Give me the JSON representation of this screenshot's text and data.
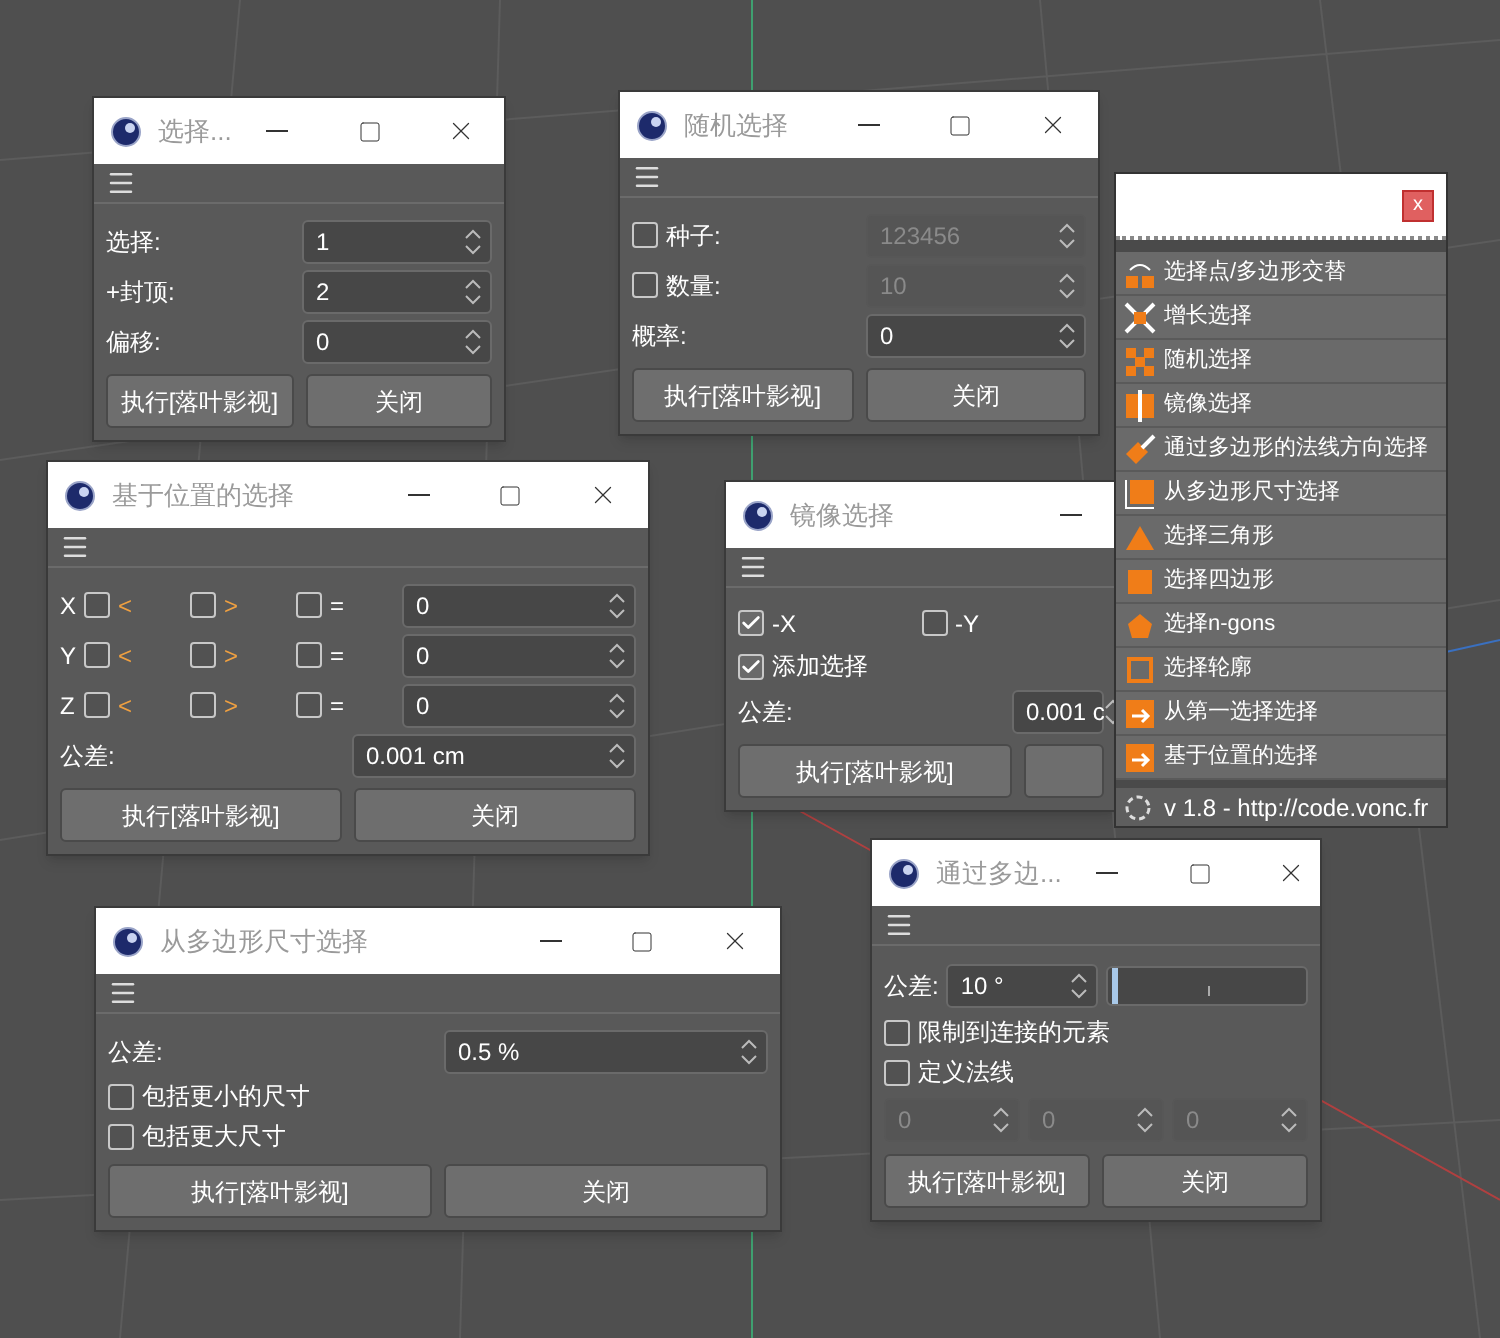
{
  "windows": [
    {
      "title": "选择...",
      "rows": [
        {
          "kind": "field",
          "label": "选择:",
          "value": "1",
          "disabled": false
        },
        {
          "kind": "field",
          "label": "+封顶:",
          "value": "2",
          "disabled": false
        },
        {
          "kind": "field",
          "label": "偏移:",
          "value": "0",
          "disabled": false
        }
      ],
      "buttons": [
        {
          "label": "执行[落叶影视]"
        },
        {
          "label": "关闭"
        }
      ]
    },
    {
      "title": "随机选择",
      "rows": [
        {
          "kind": "check_field",
          "label": "种子:",
          "checked": false,
          "value": "123456",
          "disabled": true
        },
        {
          "kind": "check_field",
          "label": "数量:",
          "checked": false,
          "value": "10",
          "disabled": true
        },
        {
          "kind": "field",
          "label": "概率:",
          "value": "0",
          "disabled": false
        }
      ],
      "buttons": [
        {
          "label": "执行[落叶影视]"
        },
        {
          "label": "关闭"
        }
      ]
    },
    {
      "title": "基于位置的选择",
      "rows": [
        {
          "kind": "axis",
          "label": "X",
          "options": [
            {
              "label": "<",
              "checked": false
            },
            {
              "label": ">",
              "checked": false
            },
            {
              "label": "=",
              "checked": false
            }
          ],
          "value": "0"
        },
        {
          "kind": "axis",
          "label": "Y",
          "options": [
            {
              "label": "<",
              "checked": false
            },
            {
              "label": ">",
              "checked": false
            },
            {
              "label": "=",
              "checked": false
            }
          ],
          "value": "0"
        },
        {
          "kind": "axis",
          "label": "Z",
          "options": [
            {
              "label": "<",
              "checked": false
            },
            {
              "label": ">",
              "checked": false
            },
            {
              "label": "=",
              "checked": false
            }
          ],
          "value": "0"
        },
        {
          "kind": "field",
          "label": "公差:",
          "value": "0.001 cm",
          "disabled": false
        }
      ],
      "buttons": [
        {
          "label": "执行[落叶影视]"
        },
        {
          "label": "关闭"
        }
      ]
    },
    {
      "title": "镜像选择",
      "rows": [
        {
          "kind": "check_pair",
          "items": [
            {
              "label": "-X",
              "checked": true
            },
            {
              "label": "-Y",
              "checked": false
            }
          ]
        },
        {
          "kind": "checkbox",
          "label": "添加选择",
          "checked": true
        },
        {
          "kind": "field",
          "label": "公差:",
          "value": "0.001 c",
          "disabled": false
        }
      ],
      "buttons": [
        {
          "label": "执行[落叶影视]"
        }
      ],
      "covered_button": true
    },
    {
      "title": "从多边形尺寸选择",
      "rows": [
        {
          "kind": "field",
          "label": "公差:",
          "value": "0.5 %",
          "disabled": false
        },
        {
          "kind": "checkbox",
          "label": "包括更小的尺寸",
          "checked": false
        },
        {
          "kind": "checkbox",
          "label": "包括更大尺寸",
          "checked": false
        }
      ],
      "buttons": [
        {
          "label": "执行[落叶影视]"
        },
        {
          "label": "关闭"
        }
      ]
    },
    {
      "title": "通过多边...",
      "rows": [
        {
          "kind": "slider_field",
          "label": "公差:",
          "value": "10 °",
          "level": 0.02
        },
        {
          "kind": "checkbox",
          "label": "限制到连接的元素",
          "checked": false
        },
        {
          "kind": "checkbox",
          "label": "定义法线",
          "checked": false
        },
        {
          "kind": "triple",
          "values": [
            "0",
            "0",
            "0"
          ],
          "disabled": true
        }
      ],
      "buttons": [
        {
          "label": "执行[落叶影视]"
        },
        {
          "label": "关闭"
        }
      ]
    }
  ],
  "menu_panel": {
    "close_label": "x",
    "items": [
      "选择点/多边形交替",
      "增长选择",
      "随机选择",
      "镜像选择",
      "通过多边形的法线方向选择",
      "从多边形尺寸选择",
      "选择三角形",
      "选择四边形",
      "选择n-gons",
      "选择轮廓",
      "从第一选择选择",
      "基于位置的选择"
    ],
    "version": "v 1.8 - http://code.vonc.fr"
  }
}
